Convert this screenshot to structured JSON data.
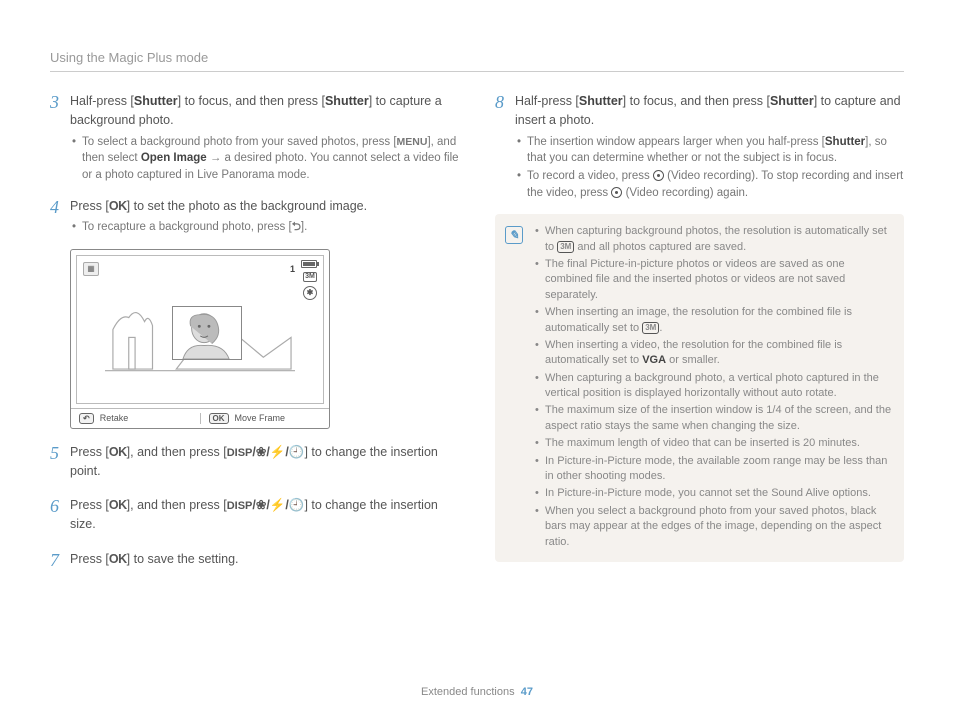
{
  "header": {
    "title": "Using the Magic Plus mode"
  },
  "footer": {
    "section": "Extended functions",
    "page": "47"
  },
  "left": {
    "step3": {
      "num": "3",
      "text_a": "Half-press [",
      "shutter1": "Shutter",
      "text_b": "] to focus, and then press [",
      "shutter2": "Shutter",
      "text_c": "] to capture a background photo.",
      "sub1_a": "To select a background photo from your saved photos, press [",
      "sub1_menu": "MENU",
      "sub1_b": "], and then select ",
      "sub1_open": "Open Image",
      "sub1_c": " → a desired photo. You cannot select a video file or a photo captured in Live Panorama mode."
    },
    "step4": {
      "num": "4",
      "text_a": "Press [",
      "ok": "OK",
      "text_b": "] to set the photo as the background image.",
      "sub1_a": "To recapture a background photo, press [",
      "sub1_b": "]."
    },
    "screen": {
      "counter": "1",
      "retake_btn": "↶",
      "retake": "Retake",
      "move_btn": "OK",
      "move": "Move Frame",
      "icon2": "3M",
      "icon3": "✱"
    },
    "step5": {
      "num": "5",
      "text_a": "Press [",
      "ok": "OK",
      "text_b": "], and then press [",
      "disp": "DISP",
      "text_c": "] to change the insertion point."
    },
    "step6": {
      "num": "6",
      "text_a": "Press [",
      "ok": "OK",
      "text_b": "], and then press [",
      "disp": "DISP",
      "text_c": "] to change the insertion size."
    },
    "step7": {
      "num": "7",
      "text_a": "Press [",
      "ok": "OK",
      "text_b": "] to save the setting."
    }
  },
  "right": {
    "step8": {
      "num": "8",
      "text_a": "Half-press [",
      "shutter1": "Shutter",
      "text_b": "] to focus, and then press [",
      "shutter2": "Shutter",
      "text_c": "] to capture and insert a photo.",
      "sub1_a": "The insertion window appears larger when you half-press [",
      "sub1_shutter": "Shutter",
      "sub1_b": "], so that you can determine whether or not the subject is in focus.",
      "sub2_a": "To record a video, press ",
      "sub2_b": " (Video recording). To stop recording and insert the video, press ",
      "sub2_c": " (Video recording) again."
    },
    "notes": {
      "n1": "When capturing background photos, the resolution is automatically set to ",
      "n1b": " and all photos captured are saved.",
      "n2": "The final Picture-in-picture photos or videos are saved as one combined file and the inserted photos or videos are not saved separately.",
      "n3": "When inserting an image, the resolution for the combined file is automatically set to ",
      "n3b": ".",
      "n4_a": "When inserting a video, the resolution for the combined file is automatically set to ",
      "n4_vga": "VGA",
      "n4_b": " or smaller.",
      "n5": "When capturing a background photo, a vertical photo captured in the vertical position is displayed horizontally without auto rotate.",
      "n6": "The maximum size of the insertion window is 1/4 of the screen, and the aspect ratio stays the same when changing the size.",
      "n7": "The maximum length of video that can be inserted is 20 minutes.",
      "n8": "In Picture-in-Picture mode, the available zoom range may be less than in other shooting modes.",
      "n9": "In Picture-in-Picture mode, you cannot set the Sound Alive options.",
      "n10": "When you select a background photo from your saved photos, black bars may appear at the edges of the image, depending on the aspect ratio."
    }
  }
}
